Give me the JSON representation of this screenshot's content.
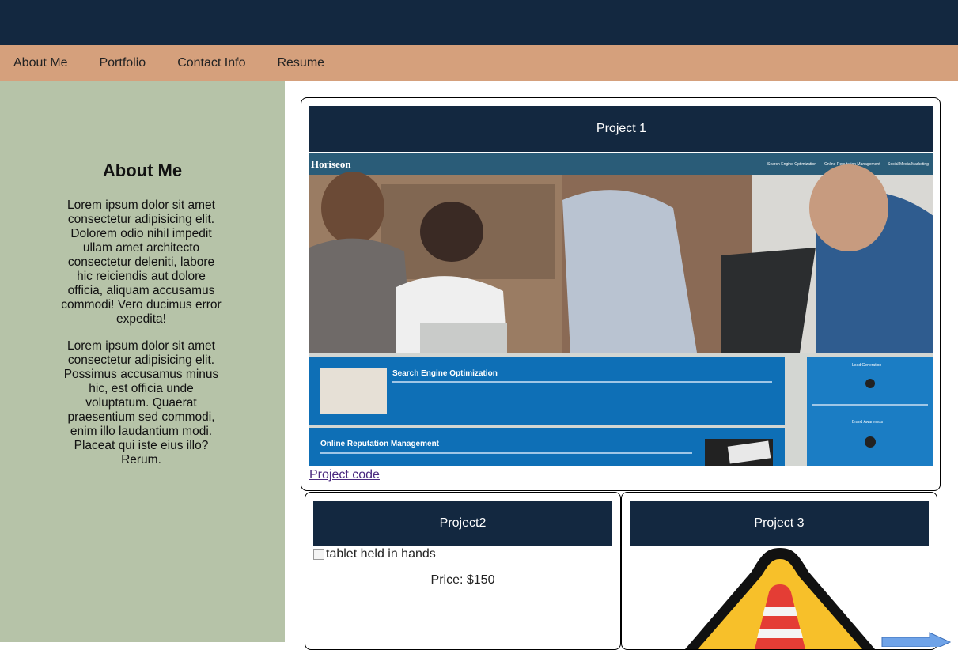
{
  "nav": {
    "items": [
      {
        "label": "About Me"
      },
      {
        "label": "Portfolio"
      },
      {
        "label": "Contact Info"
      },
      {
        "label": "Resume"
      }
    ]
  },
  "about": {
    "title": "About Me",
    "paragraphs": [
      "Lorem ipsum dolor sit amet consectetur adipisicing elit. Dolorem odio nihil impedit ullam amet architecto consectetur deleniti, labore hic reiciendis aut dolore officia, aliquam accusamus commodi! Vero ducimus error expedita!",
      "Lorem ipsum dolor sit amet consectetur adipisicing elit. Possimus accusamus minus hic, est officia unde voluptatum. Quaerat praesentium sed commodi, enim illo laudantium modi. Placeat qui iste eius illo? Rerum."
    ]
  },
  "projects": [
    {
      "title": "Project 1",
      "link_label": "Project code",
      "screenshot": {
        "brand": "Horiseon",
        "nav": [
          "Search Engine Optimization",
          "Online Reputation Management",
          "Social Media Marketing"
        ],
        "sections": [
          "Search Engine Optimization",
          "Online Reputation Management"
        ],
        "side": [
          "Lead Generation",
          "Brand Awareness"
        ]
      }
    },
    {
      "title": "Project2",
      "image_alt": "tablet held in hands",
      "price": "Price: $150"
    },
    {
      "title": "Project 3"
    }
  ],
  "colors": {
    "header": "#132840",
    "nav": "#d5a07c",
    "sidebar": "#b6c3a8",
    "link": "#4b2a80"
  }
}
